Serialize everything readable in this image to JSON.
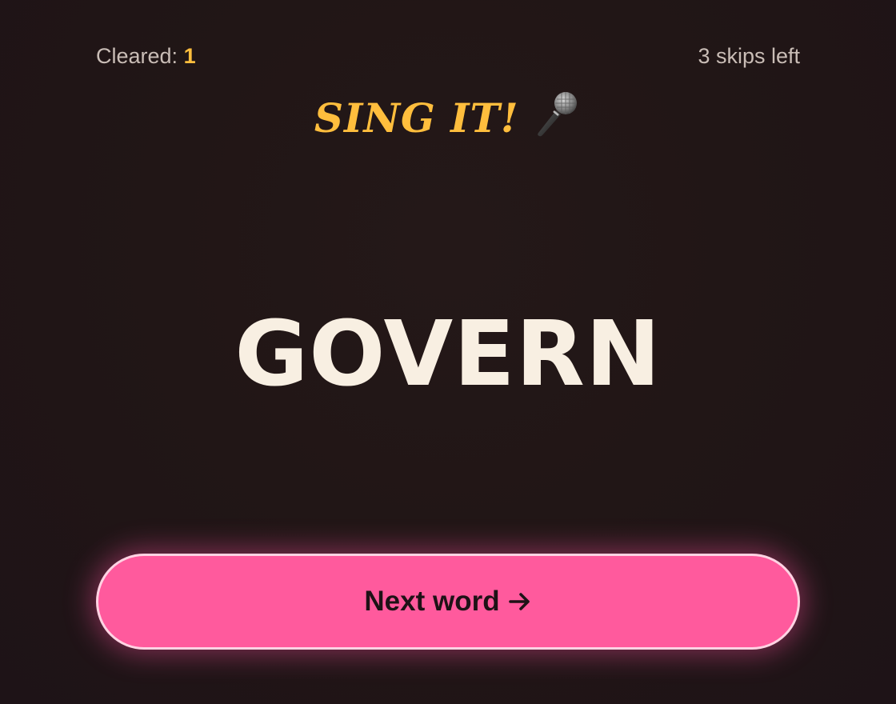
{
  "status": {
    "cleared_label": "Cleared:",
    "cleared_count": "1",
    "skips_text": "3 skips left"
  },
  "banner": {
    "title": "SING IT!",
    "icon": "microphone-icon"
  },
  "card": {
    "word": "GOVERN"
  },
  "actions": {
    "next_label": "Next word",
    "next_icon": "arrow-right-icon"
  },
  "colors": {
    "background": "#211616",
    "accent_yellow": "#ffbe3d",
    "button_pink": "#ff5a9d",
    "word_color": "#f8efe2"
  }
}
